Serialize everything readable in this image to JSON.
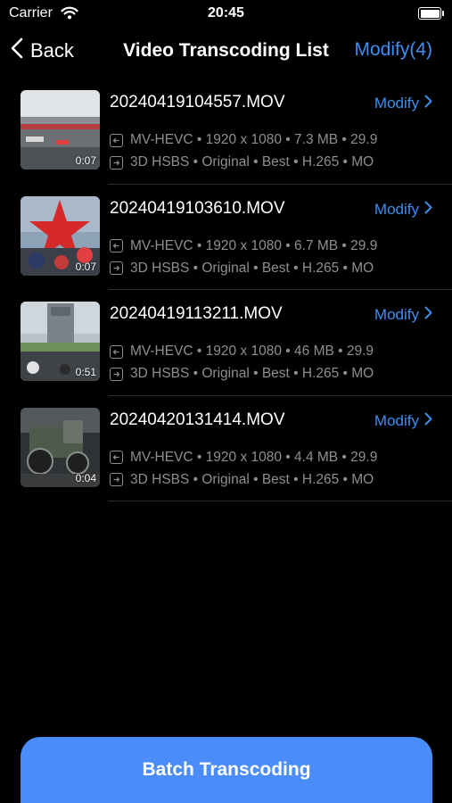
{
  "status_bar": {
    "carrier": "Carrier",
    "time": "20:45"
  },
  "nav": {
    "back_label": "Back",
    "title": "Video Transcoding List",
    "modify_all": "Modify(4)"
  },
  "videos": [
    {
      "name": "20240419104557.MOV",
      "duration": "0:07",
      "modify_label": "Modify",
      "input_info": "MV-HEVC • 1920 x 1080 • 7.3 MB • 29.9",
      "output_info": "3D HSBS • Original • Best • H.265 • MO"
    },
    {
      "name": "20240419103610.MOV",
      "duration": "0:07",
      "modify_label": "Modify",
      "input_info": "MV-HEVC • 1920 x 1080 • 6.7 MB • 29.9",
      "output_info": "3D HSBS • Original • Best • H.265 • MO"
    },
    {
      "name": "20240419113211.MOV",
      "duration": "0:51",
      "modify_label": "Modify",
      "input_info": "MV-HEVC • 1920 x 1080 • 46 MB • 29.9",
      "output_info": "3D HSBS • Original • Best • H.265 • MO"
    },
    {
      "name": "20240420131414.MOV",
      "duration": "0:04",
      "modify_label": "Modify",
      "input_info": "MV-HEVC • 1920 x 1080 • 4.4 MB • 29.9",
      "output_info": "3D HSBS • Original • Best • H.265 • MO"
    }
  ],
  "batch_button_label": "Batch Transcoding",
  "colors": {
    "accent": "#3d8ef0",
    "button": "#4a8df8",
    "background": "#000000",
    "secondary_text": "#8e8e93"
  }
}
